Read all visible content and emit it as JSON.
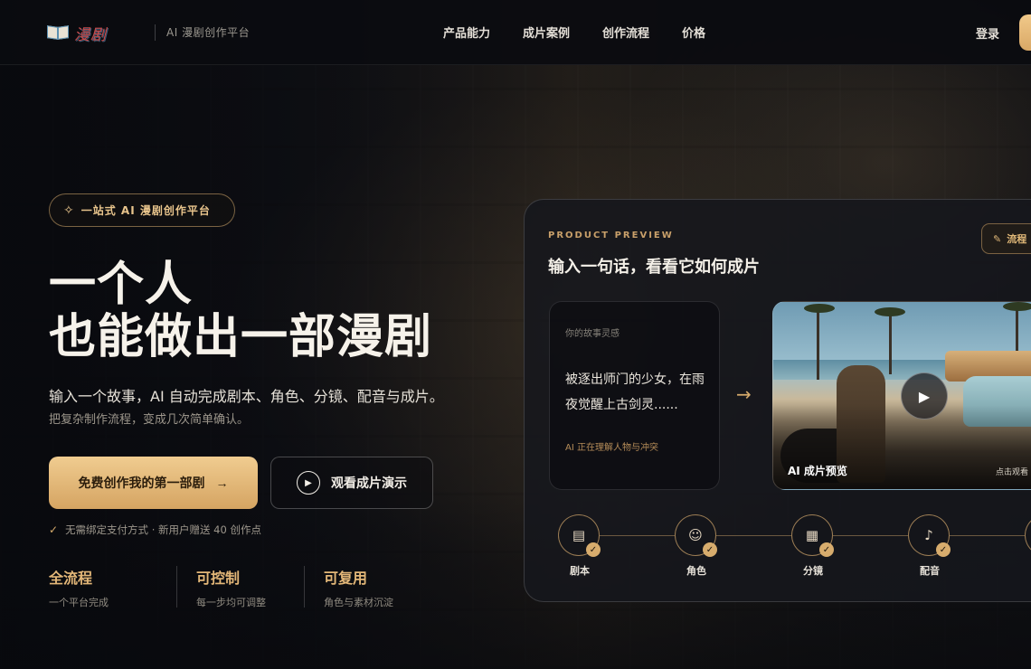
{
  "header": {
    "logo_text": "漫剧",
    "tagline": "AI 漫剧创作平台",
    "nav": [
      "产品能力",
      "成片案例",
      "创作流程",
      "价格"
    ],
    "login": "登录"
  },
  "hero": {
    "badge": "一站式 AI 漫剧创作平台",
    "title_line1": "一个人",
    "title_line2": "也能做出一部漫剧",
    "subtitle": "输入一个故事，AI 自动完成剧本、角色、分镜、配音与成片。",
    "subtitle2": "把复杂制作流程，变成几次简单确认。",
    "primary_button": "免费创作我的第一部剧",
    "secondary_button": "观看成片演示",
    "note": "无需绑定支付方式 · 新用户赠送 40 创作点",
    "features": [
      {
        "title": "全流程",
        "desc": "一个平台完成"
      },
      {
        "title": "可控制",
        "desc": "每一步均可调整"
      },
      {
        "title": "可复用",
        "desc": "角色与素材沉淀"
      }
    ]
  },
  "preview": {
    "label": "PRODUCT PREVIEW",
    "title": "输入一句话，看看它如何成片",
    "flow_button": "流程",
    "story_caption": "你的故事灵感",
    "story_text": "被逐出师门的少女，在雨夜觉醒上古剑灵......",
    "story_status": "AI 正在理解人物与冲突",
    "video_label": "AI 成片预览",
    "video_hint": "点击观看",
    "steps": [
      {
        "label": "剧本",
        "icon": "script-icon"
      },
      {
        "label": "角色",
        "icon": "character-icon"
      },
      {
        "label": "分镜",
        "icon": "storyboard-icon"
      },
      {
        "label": "配音",
        "icon": "voice-icon"
      }
    ]
  },
  "colors": {
    "accent": "#d6ab6c",
    "accent_light": "#f0cc90",
    "background": "#0b0d12"
  }
}
